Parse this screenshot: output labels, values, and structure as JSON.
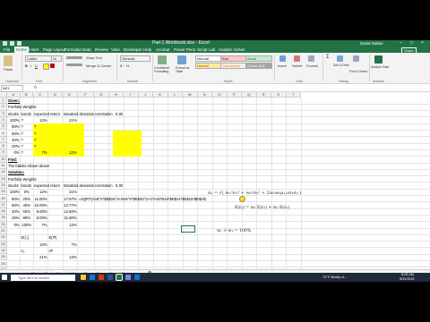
{
  "window": {
    "title": "Part 1 Workbook.xlsx  -  Excel",
    "user": "David Rabiei",
    "controls": [
      "–",
      "□",
      "×"
    ]
  },
  "ribbon": {
    "tabs": [
      "File",
      "Home",
      "Insert",
      "Page Layout",
      "Formulas",
      "Data",
      "Review",
      "View",
      "Developer",
      "Help",
      "Acrobat",
      "Power Pivot",
      "Script Lab",
      "Analytic Solver"
    ],
    "selected_tab": "Home",
    "share": "Share",
    "font_name": "Calibri",
    "font_size": "11",
    "wrap_text": "Wrap Text",
    "merge_center": "Merge & Center",
    "number_format": "General",
    "styles": [
      {
        "label": "Normal",
        "bg": "#ffffff",
        "fg": "#000000"
      },
      {
        "label": "Bad",
        "bg": "#ffc7ce",
        "fg": "#9c0006"
      },
      {
        "label": "Good",
        "bg": "#c6efce",
        "fg": "#006100"
      },
      {
        "label": "Neutral",
        "bg": "#ffeb9c",
        "fg": "#9c5700"
      },
      {
        "label": "Calculation",
        "bg": "#f2f2f2",
        "fg": "#fa7d00"
      },
      {
        "label": "Check Cell",
        "bg": "#a5a5a5",
        "fg": "#ffffff"
      }
    ],
    "buttons": [
      "Paste",
      "Conditional Formatting",
      "Format as Table",
      "Insert",
      "Delete",
      "Format",
      "Sort & Filter",
      "Find & Select",
      "Analyze Data"
    ],
    "groups": [
      "Clipboard",
      "Font",
      "Alignment",
      "Number",
      "Styles",
      "Cells",
      "Editing",
      "Analysis"
    ],
    "colors": {
      "accent": "#217346",
      "ribbon_bg": "#f3f3f3"
    }
  },
  "formula_bar": {
    "name_box": "N21",
    "fx": "fx",
    "value": ""
  },
  "columns": [
    "A",
    "B",
    "C",
    "D",
    "E",
    "F",
    "G",
    "H",
    "I",
    "J",
    "K",
    "L",
    "M",
    "N",
    "O",
    "P",
    "Q",
    "R",
    "S",
    "T"
  ],
  "rows": [
    "1",
    "2",
    "3",
    "4",
    "5",
    "6",
    "7",
    "8",
    "9",
    "10",
    "11",
    "12",
    "13",
    "14",
    "15",
    "16",
    "17",
    "18",
    "19",
    "20",
    "21",
    "22",
    "23",
    "24",
    "25",
    "26",
    "27"
  ],
  "cells": {
    "a1": "Given:",
    "a2": "Portfolio Weights",
    "a3": "stocks",
    "b3": "bonds",
    "c3": "expected return",
    "e3": "standard deviation",
    "g3": "correlation",
    "h3": "0.30",
    "a4": "100%",
    "b4": "?",
    "c4": "12%",
    "e4": "21%",
    "a5": "80%",
    "b5": "?",
    "c5": "?",
    "a6": "60%",
    "b6": "?",
    "c6": "?",
    "a7": "40%",
    "b7": "?",
    "c7": "?",
    "a8": "20%",
    "b8": "?",
    "c8": "?",
    "a9": "0%",
    "b9": "?",
    "c9": "7%",
    "e9": "12%",
    "a10": "Find:",
    "a11": "The blanks shown above",
    "a12": "Solution:",
    "a13": "Portfolio Weights",
    "a14": "stocks",
    "b14": "bonds",
    "c14": "expected return",
    "e14": "standard deviation",
    "g14": "correlation",
    "h14": "0.30",
    "a15": "100%",
    "b15": "0%",
    "c15": "12%",
    "e15": "21%",
    "a16": "80%",
    "b16": "20%",
    "c16": "11.00%",
    "e16": "17.67%",
    "f16": "=SQRT(A16^2*$E$15^2+B16^2*$E$20^2+2*A16*B16*$E$14*$E$15*$E$20)",
    "a17": "60%",
    "b17": "40%",
    "c17": "10.00%",
    "e17": "14.77%",
    "a18": "40%",
    "b18": "60%",
    "c18": "9.00%",
    "e18": "12.60%",
    "a19": "20%",
    "b19": "80%",
    "c19": "8.00%",
    "e19": "11.58%",
    "a20": "0%",
    "b20": "100%",
    "c20": "7%",
    "e20": "12%",
    "b22": "E(rₛ)",
    "d22": "E(rᴮ)",
    "c23": "12%",
    "e23": "7%",
    "b24": "σₛ",
    "d24": "σᴮ",
    "c25": "21%",
    "e25": "12%"
  },
  "equations": {
    "sigma": "σₚ = √( w₁²σ₁² + w₂²σ₂² + 2w₁w₂ρ₁,₂σ₁σ₂ )",
    "expected": "E(rₚ) = w₁ E(r₁) + w₂ E(r₂)",
    "weights": "w₁ + w₂ = 100%"
  },
  "sheet_tabs": [
    "...",
    "11",
    "12",
    "13",
    "14",
    "15",
    "16",
    "17",
    "18",
    "..."
  ],
  "selected_sheet": "13",
  "status": {
    "left": "Ready",
    "zoom": "100%"
  },
  "taskbar": {
    "search_placeholder": "Type here to search",
    "time": "8:28 AM",
    "date": "5/31/2021",
    "weather": "73°F  Mostly cl..."
  }
}
